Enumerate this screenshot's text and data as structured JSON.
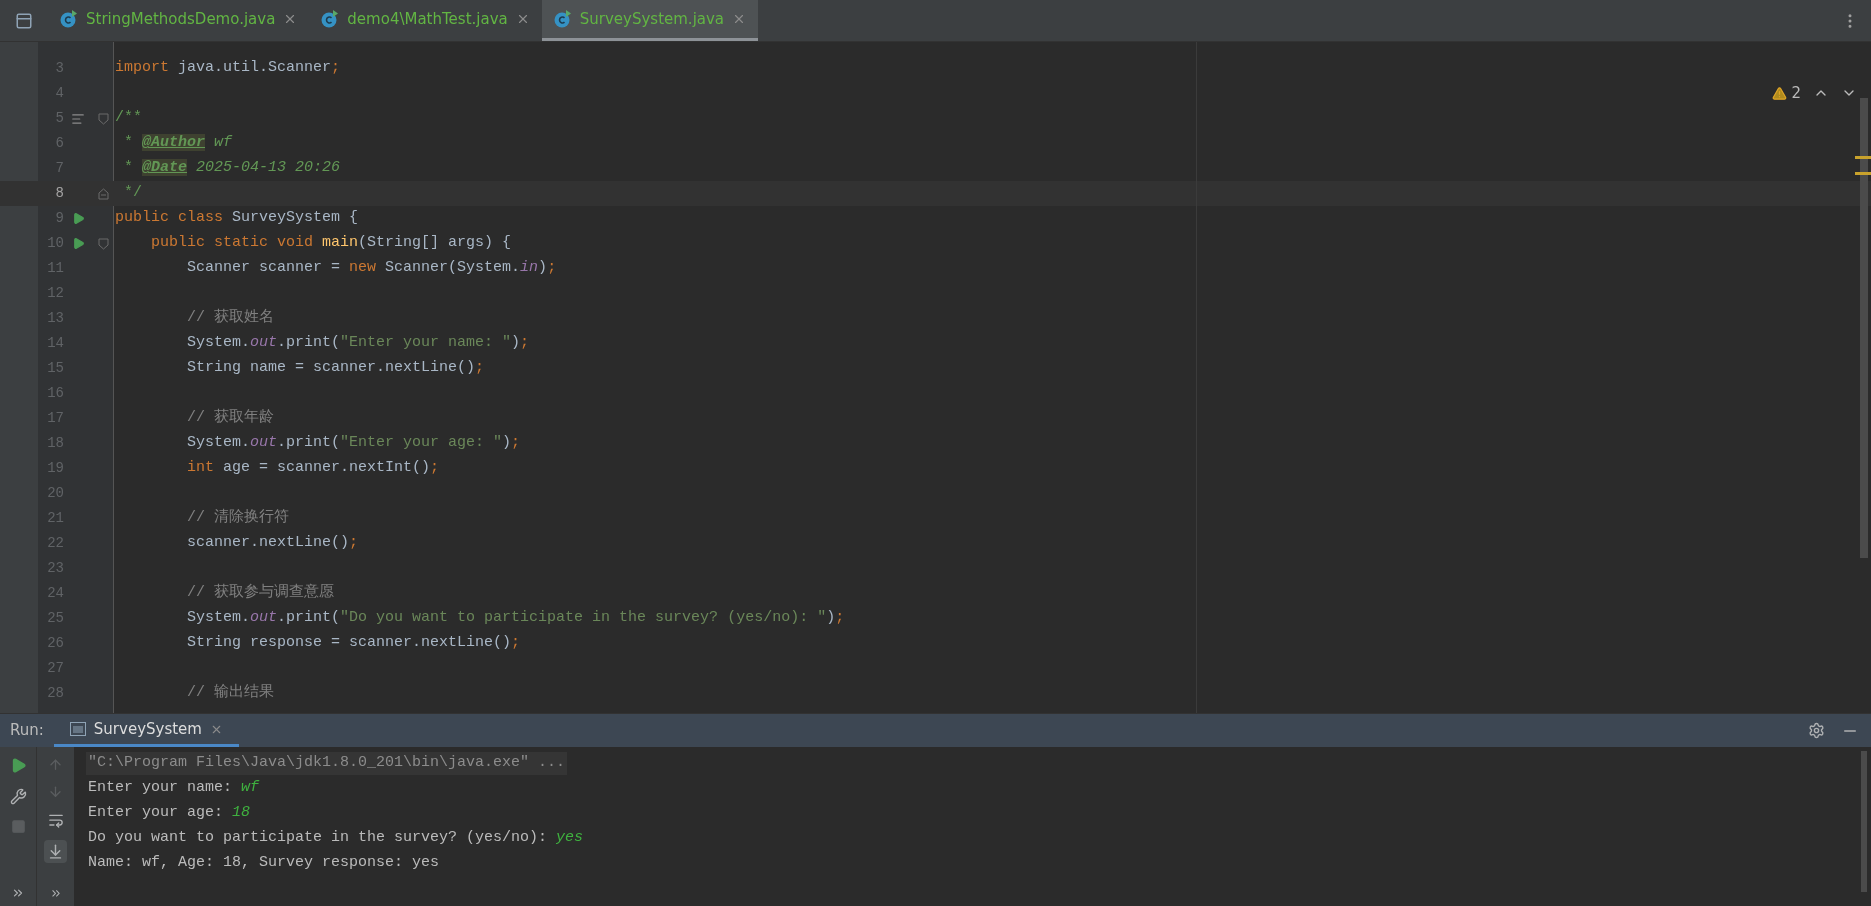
{
  "tabs": [
    {
      "label": "StringMethodsDemo.java",
      "selected": false
    },
    {
      "label": "demo4\\MathTest.java",
      "selected": false
    },
    {
      "label": "SurveySystem.java",
      "selected": true
    }
  ],
  "editor": {
    "warning_count": "2",
    "lines": [
      {
        "number": "3",
        "current": false,
        "run": false,
        "doc": false,
        "fold_start": false,
        "fold_end": false,
        "tokens": [
          {
            "kind": "keyword",
            "text": "import "
          },
          {
            "kind": "plain",
            "text": "java.util.Scanner"
          },
          {
            "kind": "keyword",
            "text": ";"
          }
        ]
      },
      {
        "number": "4",
        "current": false,
        "run": false,
        "doc": false,
        "fold_start": false,
        "fold_end": false
      },
      {
        "number": "5",
        "current": false,
        "run": false,
        "doc": true,
        "fold_start": true,
        "fold_end": false,
        "tokens": [
          {
            "kind": "doc",
            "text": "/**"
          }
        ]
      },
      {
        "number": "6",
        "current": false,
        "run": false,
        "doc": false,
        "fold_start": false,
        "fold_end": false,
        "tokens": [
          {
            "kind": "doc",
            "text": " * "
          },
          {
            "kind": "doctag",
            "text": "@Author"
          },
          {
            "kind": "docitalic",
            "text": " wf"
          }
        ]
      },
      {
        "number": "7",
        "current": false,
        "run": false,
        "doc": false,
        "fold_start": false,
        "fold_end": false,
        "tokens": [
          {
            "kind": "doc",
            "text": " * "
          },
          {
            "kind": "doctag",
            "text": "@Date"
          },
          {
            "kind": "docitalic",
            "text": " 2025-04-13 20:26"
          }
        ]
      },
      {
        "number": "8",
        "current": true,
        "run": false,
        "doc": false,
        "fold_start": false,
        "fold_end": true,
        "tokens": [
          {
            "kind": "doc",
            "text": " */"
          }
        ]
      },
      {
        "number": "9",
        "current": false,
        "run": true,
        "doc": false,
        "fold_start": false,
        "fold_end": false,
        "tokens": [
          {
            "kind": "keyword",
            "text": "public class "
          },
          {
            "kind": "plain",
            "text": "SurveySystem {"
          }
        ]
      },
      {
        "number": "10",
        "current": false,
        "run": true,
        "doc": false,
        "fold_start": true,
        "fold_end": false,
        "tokens": [
          {
            "kind": "keyword",
            "text": "    public static void "
          },
          {
            "kind": "method",
            "text": "main"
          },
          {
            "kind": "plain",
            "text": "(String[] args) {"
          }
        ]
      },
      {
        "number": "11",
        "current": false,
        "run": false,
        "doc": false,
        "fold_start": false,
        "fold_end": false,
        "tokens": [
          {
            "kind": "plain",
            "text": "        Scanner scanner = "
          },
          {
            "kind": "keyword",
            "text": "new "
          },
          {
            "kind": "plain",
            "text": "Scanner(System."
          },
          {
            "kind": "field",
            "text": "in"
          },
          {
            "kind": "plain",
            "text": ")"
          },
          {
            "kind": "keyword",
            "text": ";"
          }
        ]
      },
      {
        "number": "12",
        "current": false,
        "run": false,
        "doc": false,
        "fold_start": false,
        "fold_end": false
      },
      {
        "number": "13",
        "current": false,
        "run": false,
        "doc": false,
        "fold_start": false,
        "fold_end": false,
        "tokens": [
          {
            "kind": "comment",
            "text": "        // 获取姓名"
          }
        ]
      },
      {
        "number": "14",
        "current": false,
        "run": false,
        "doc": false,
        "fold_start": false,
        "fold_end": false,
        "tokens": [
          {
            "kind": "plain",
            "text": "        System."
          },
          {
            "kind": "field",
            "text": "out"
          },
          {
            "kind": "plain",
            "text": ".print("
          },
          {
            "kind": "string",
            "text": "\"Enter your name: \""
          },
          {
            "kind": "plain",
            "text": ")"
          },
          {
            "kind": "keyword",
            "text": ";"
          }
        ]
      },
      {
        "number": "15",
        "current": false,
        "run": false,
        "doc": false,
        "fold_start": false,
        "fold_end": false,
        "tokens": [
          {
            "kind": "plain",
            "text": "        String name = scanner.nextLine()"
          },
          {
            "kind": "keyword",
            "text": ";"
          }
        ]
      },
      {
        "number": "16",
        "current": false,
        "run": false,
        "doc": false,
        "fold_start": false,
        "fold_end": false
      },
      {
        "number": "17",
        "current": false,
        "run": false,
        "doc": false,
        "fold_start": false,
        "fold_end": false,
        "tokens": [
          {
            "kind": "comment",
            "text": "        // 获取年龄"
          }
        ]
      },
      {
        "number": "18",
        "current": false,
        "run": false,
        "doc": false,
        "fold_start": false,
        "fold_end": false,
        "tokens": [
          {
            "kind": "plain",
            "text": "        System."
          },
          {
            "kind": "field",
            "text": "out"
          },
          {
            "kind": "plain",
            "text": ".print("
          },
          {
            "kind": "string",
            "text": "\"Enter your age: \""
          },
          {
            "kind": "plain",
            "text": ")"
          },
          {
            "kind": "keyword",
            "text": ";"
          }
        ]
      },
      {
        "number": "19",
        "current": false,
        "run": false,
        "doc": false,
        "fold_start": false,
        "fold_end": false,
        "tokens": [
          {
            "kind": "keyword",
            "text": "        int "
          },
          {
            "kind": "plain",
            "text": "age = scanner.nextInt()"
          },
          {
            "kind": "keyword",
            "text": ";"
          }
        ]
      },
      {
        "number": "20",
        "current": false,
        "run": false,
        "doc": false,
        "fold_start": false,
        "fold_end": false
      },
      {
        "number": "21",
        "current": false,
        "run": false,
        "doc": false,
        "fold_start": false,
        "fold_end": false,
        "tokens": [
          {
            "kind": "comment",
            "text": "        // 清除换行符"
          }
        ]
      },
      {
        "number": "22",
        "current": false,
        "run": false,
        "doc": false,
        "fold_start": false,
        "fold_end": false,
        "tokens": [
          {
            "kind": "plain",
            "text": "        scanner.nextLine()"
          },
          {
            "kind": "keyword",
            "text": ";"
          }
        ]
      },
      {
        "number": "23",
        "current": false,
        "run": false,
        "doc": false,
        "fold_start": false,
        "fold_end": false
      },
      {
        "number": "24",
        "current": false,
        "run": false,
        "doc": false,
        "fold_start": false,
        "fold_end": false,
        "tokens": [
          {
            "kind": "comment",
            "text": "        // 获取参与调查意愿"
          }
        ]
      },
      {
        "number": "25",
        "current": false,
        "run": false,
        "doc": false,
        "fold_start": false,
        "fold_end": false,
        "tokens": [
          {
            "kind": "plain",
            "text": "        System."
          },
          {
            "kind": "field",
            "text": "out"
          },
          {
            "kind": "plain",
            "text": ".print("
          },
          {
            "kind": "string",
            "text": "\"Do you want to participate in the survey? (yes/no): \""
          },
          {
            "kind": "plain",
            "text": ")"
          },
          {
            "kind": "keyword",
            "text": ";"
          }
        ]
      },
      {
        "number": "26",
        "current": false,
        "run": false,
        "doc": false,
        "fold_start": false,
        "fold_end": false,
        "tokens": [
          {
            "kind": "plain",
            "text": "        String response = scanner.nextLine()"
          },
          {
            "kind": "keyword",
            "text": ";"
          }
        ]
      },
      {
        "number": "27",
        "current": false,
        "run": false,
        "doc": false,
        "fold_start": false,
        "fold_end": false
      },
      {
        "number": "28",
        "current": false,
        "run": false,
        "doc": false,
        "fold_start": false,
        "fold_end": false,
        "tokens": [
          {
            "kind": "comment",
            "text": "        // 输出结果"
          }
        ]
      }
    ]
  },
  "run_panel": {
    "label": "Run:",
    "tab": "SurveySystem",
    "console": [
      {
        "kind": "command",
        "segments": [
          {
            "kind": "output",
            "text": "\"C:\\Program Files\\Java\\jdk1.8.0_201\\bin\\java.exe\" ..."
          }
        ]
      },
      {
        "kind": "normal",
        "segments": [
          {
            "kind": "output",
            "text": "Enter your name: "
          },
          {
            "kind": "input",
            "text": "wf"
          }
        ]
      },
      {
        "kind": "normal",
        "segments": [
          {
            "kind": "output",
            "text": "Enter your age: "
          },
          {
            "kind": "input",
            "text": "18"
          }
        ]
      },
      {
        "kind": "normal",
        "segments": [
          {
            "kind": "output",
            "text": "Do you want to participate in the survey? (yes/no): "
          },
          {
            "kind": "input",
            "text": "yes"
          }
        ]
      },
      {
        "kind": "normal",
        "segments": [
          {
            "kind": "output",
            "text": "Name: wf, Age: 18, Survey response: yes"
          }
        ]
      }
    ]
  }
}
